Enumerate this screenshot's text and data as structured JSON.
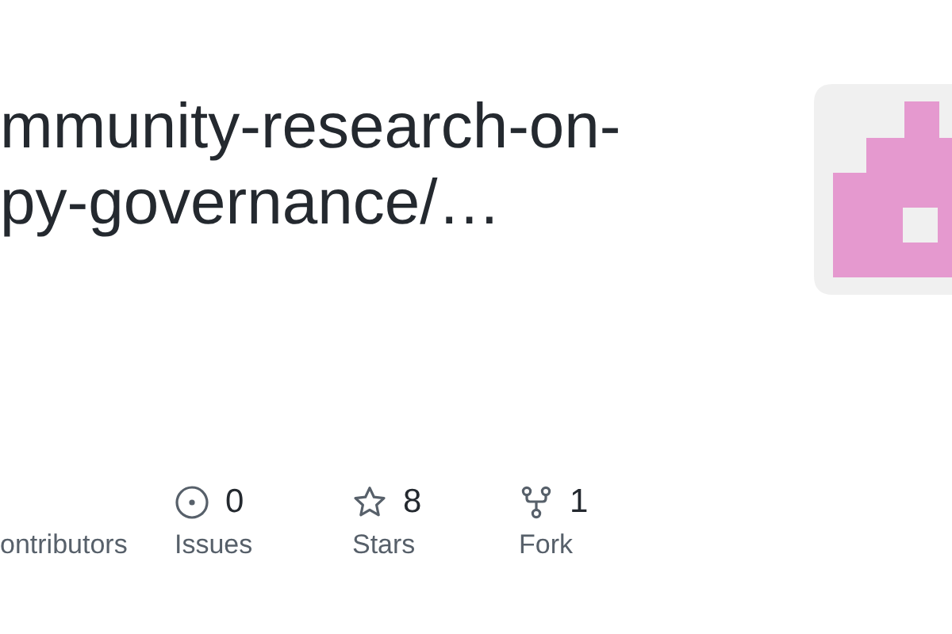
{
  "repo_title": {
    "lines": [
      "mmunity-research-on-",
      "py-governance/…"
    ]
  },
  "stats": [
    {
      "kind": "contributors",
      "label": "ontributors"
    },
    {
      "kind": "issues",
      "count": "0",
      "label": "Issues"
    },
    {
      "kind": "stars",
      "count": "8",
      "label": "Stars"
    },
    {
      "kind": "forks",
      "count": "1",
      "label": "Fork"
    }
  ]
}
